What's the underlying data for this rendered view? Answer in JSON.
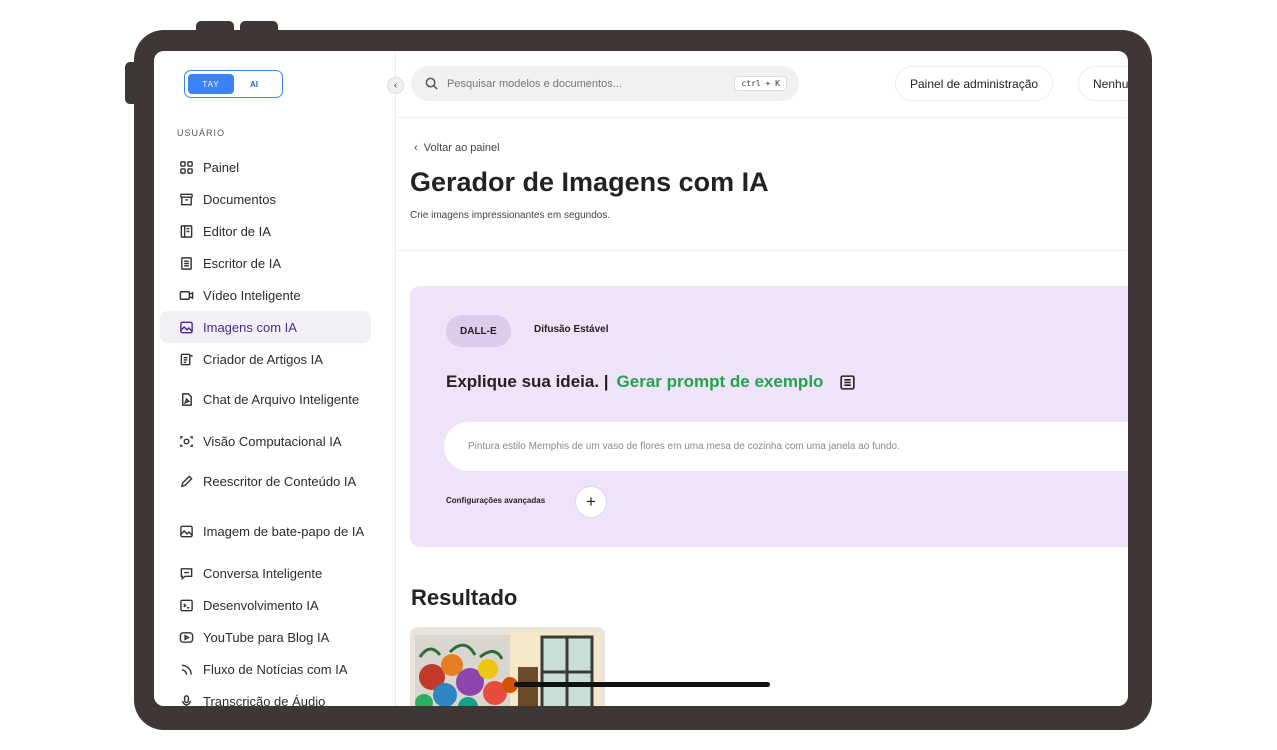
{
  "logo": {
    "left": "TAY",
    "right": "AI"
  },
  "sidebar": {
    "section": "USUÁRIO",
    "items": [
      {
        "label": "Painel",
        "icon": "grid-icon"
      },
      {
        "label": "Documentos",
        "icon": "archive-icon"
      },
      {
        "label": "Editor de IA",
        "icon": "editor-icon"
      },
      {
        "label": "Escritor de IA",
        "icon": "document-text-icon"
      },
      {
        "label": "Vídeo Inteligente",
        "icon": "video-icon"
      },
      {
        "label": "Imagens com IA",
        "icon": "image-icon",
        "active": true
      },
      {
        "label": "Criador de Artigos IA",
        "icon": "article-icon"
      },
      {
        "label": "Chat de Arquivo Inteligente",
        "icon": "file-chat-icon"
      },
      {
        "label": "Visão Computacional IA",
        "icon": "scan-eye-icon"
      },
      {
        "label": "Reescritor de Conteúdo IA",
        "icon": "pencil-icon"
      },
      {
        "label": "Imagem de bate-papo de IA",
        "icon": "image-chat-icon"
      },
      {
        "label": "Conversa Inteligente",
        "icon": "message-icon"
      },
      {
        "label": "Desenvolvimento IA",
        "icon": "terminal-icon"
      },
      {
        "label": "YouTube para Blog IA",
        "icon": "youtube-icon"
      },
      {
        "label": "Fluxo de Notícias com IA",
        "icon": "rss-icon"
      },
      {
        "label": "Transcrição de Áudio",
        "icon": "microphone-icon"
      }
    ]
  },
  "topbar": {
    "search_placeholder": "Pesquisar modelos e documentos...",
    "shortcut": "ctrl + K",
    "admin_label": "Painel de administração",
    "next_label": "Nenhu"
  },
  "main": {
    "back_label": "Voltar ao painel",
    "title": "Gerador de Imagens com IA",
    "subtitle": "Crie imagens impressionantes em segundos.",
    "tab_dalle": "DALL-E",
    "tab_diffusion": "Difusão Estável",
    "idea_label": "Explique sua ideia. |",
    "generate_example": "Gerar prompt de exemplo",
    "prompt_placeholder": "Pintura estilo Memphis de um vaso de flores em uma mesa de cozinha com uma janela ao fundo.",
    "advanced_label": "Configurações avançadas",
    "result_title": "Resultado"
  },
  "colors": {
    "frame": "#3f3636",
    "accent_purple": "#efe3fa",
    "accent_green": "#22a34a",
    "logo_blue": "#3b82f6"
  }
}
